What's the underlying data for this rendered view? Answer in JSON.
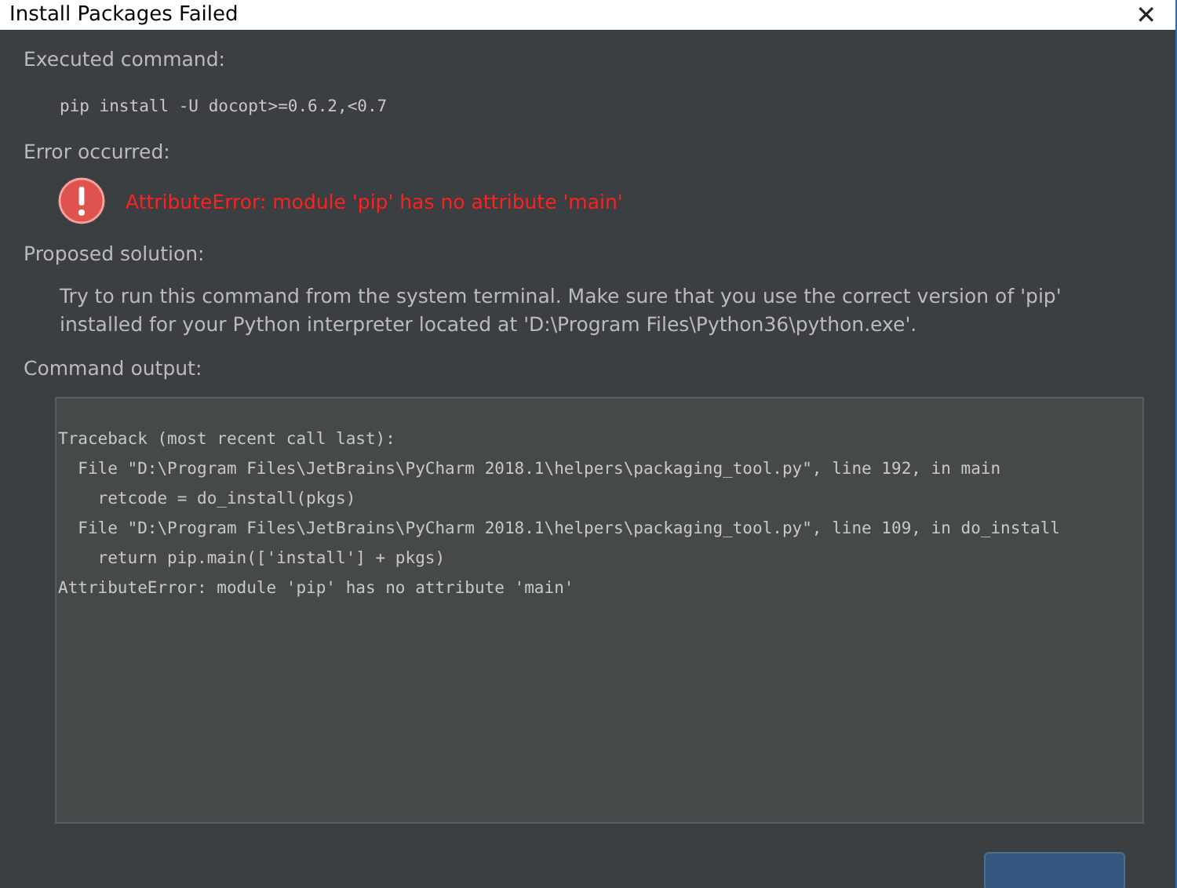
{
  "window": {
    "title": "Install Packages Failed",
    "close": "✕"
  },
  "sections": [
    {
      "kind": "command",
      "heading": "Executed command:",
      "text": "pip install -U docopt>=0.6.2,<0.7"
    },
    {
      "kind": "error",
      "heading": "Error occurred:",
      "text": "AttributeError: module 'pip' has no attribute 'main'"
    },
    {
      "kind": "solution",
      "heading": "Proposed solution:",
      "text": "Try to run this command from the system terminal. Make sure that you use the correct version of 'pip' installed for your Python interpreter located at 'D:\\Program Files\\Python36\\python.exe'."
    },
    {
      "kind": "output",
      "heading": "Command output:",
      "lines": [
        "Traceback (most recent call last):",
        "  File \"D:\\Program Files\\JetBrains\\PyCharm 2018.1\\helpers\\packaging_tool.py\", line 192, in main",
        "    retcode = do_install(pkgs)",
        "  File \"D:\\Program Files\\JetBrains\\PyCharm 2018.1\\helpers\\packaging_tool.py\", line 109, in do_install",
        "    return pip.main(['install'] + pkgs)",
        "AttributeError: module 'pip' has no attribute 'main'"
      ]
    }
  ],
  "buttons": [
    {
      "kind": "primary"
    }
  ]
}
